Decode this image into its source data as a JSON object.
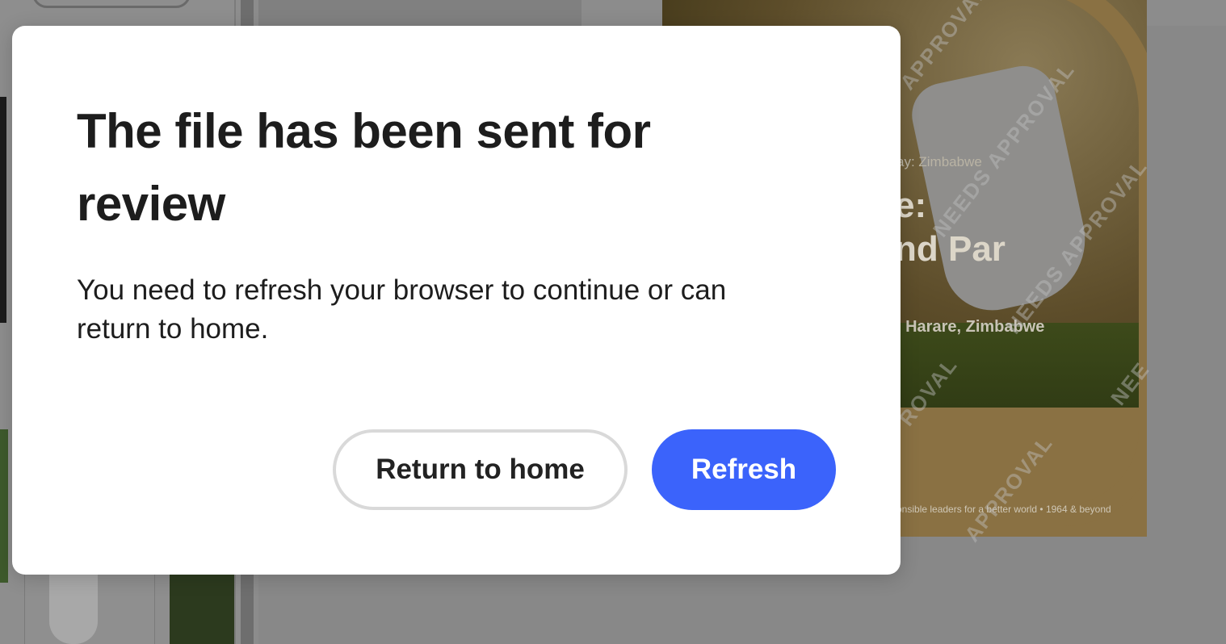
{
  "background": {
    "poster": {
      "small_text": "ay: Zimbabwe",
      "headline_line1": "e:",
      "headline_line2": "nd Par",
      "location": ", Harare, Zimbabwe",
      "footer": "onsible leaders for a better world • 1964 & beyond"
    },
    "watermarks": [
      "APPROVAL",
      "NEEDS APPROVAL",
      "NEEDS APPROVAL",
      "ROVAL",
      "APPROVAL",
      "NEE"
    ]
  },
  "dialog": {
    "title": "The file has been sent for review",
    "message": "You need to refresh your browser to continue or can return to home.",
    "secondary_button": "Return to home",
    "primary_button": "Refresh"
  },
  "colors": {
    "primary": "#3b63fb",
    "overlay": "#8c8c8c",
    "text": "#1d1d1d"
  }
}
